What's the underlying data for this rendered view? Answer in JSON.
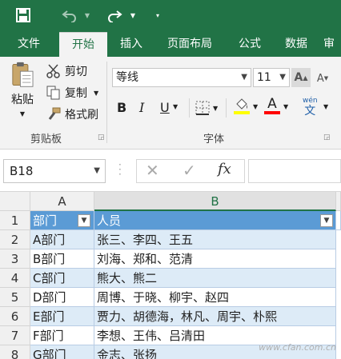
{
  "qat": {
    "save_icon": "save-icon",
    "undo_icon": "undo-icon",
    "redo_icon": "redo-icon",
    "customize_icon": "dropdown-icon"
  },
  "tabs": [
    "文件",
    "开始",
    "插入",
    "页面布局",
    "公式",
    "数据",
    "审"
  ],
  "active_tab": "开始",
  "clipboard": {
    "paste_label": "粘贴",
    "cut_label": "剪切",
    "copy_label": "复制",
    "format_painter_label": "格式刷",
    "group_label": "剪贴板"
  },
  "font": {
    "name": "等线",
    "size": "11",
    "bold": "B",
    "italic": "I",
    "underline": "U",
    "group_label": "字体",
    "colors": {
      "highlight": "#ffff00",
      "font_color": "#ff0000"
    }
  },
  "formula_bar": {
    "name_box": "B18",
    "fx_label": "fx",
    "content": ""
  },
  "sheet": {
    "columns": [
      "A",
      "B"
    ],
    "selected_column": "B",
    "rows": [
      "1",
      "2",
      "3",
      "4",
      "5",
      "6",
      "7",
      "8"
    ],
    "header": [
      "部门",
      "人员"
    ],
    "data": [
      [
        "A部门",
        "张三、李四、王五"
      ],
      [
        "B部门",
        "刘海、郑和、范清"
      ],
      [
        "C部门",
        "熊大、熊二"
      ],
      [
        "D部门",
        "周博、于晓、柳宇、赵四"
      ],
      [
        "E部门",
        "贾力、胡德海，林凡、周宇、朴熙"
      ],
      [
        "F部门",
        "李想、王伟、吕清田"
      ],
      [
        "G部门",
        "金志、张扬"
      ]
    ]
  },
  "watermark": "www.cfan.com.cn",
  "theme": {
    "brand": "#217346",
    "table_header": "#5b9bd5",
    "band": "#ddebf7"
  }
}
